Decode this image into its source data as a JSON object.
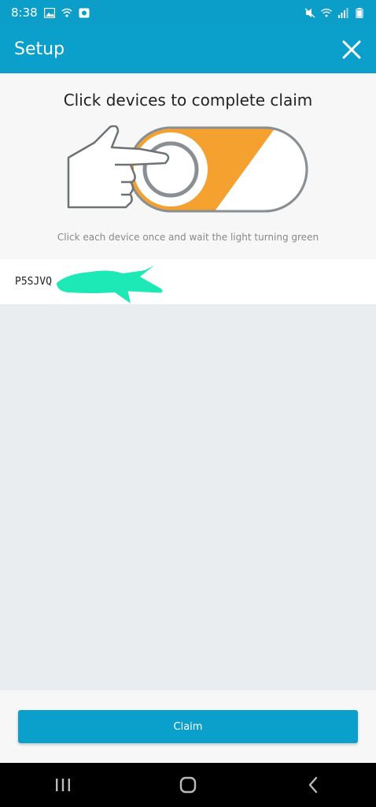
{
  "status_bar": {
    "time": "8:38",
    "left_icons": [
      "image-icon",
      "wifi-calling-icon",
      "app-notification-icon"
    ],
    "right_icons": [
      "mute-icon",
      "wifi-icon",
      "signal-icon",
      "battery-icon"
    ]
  },
  "app_bar": {
    "title": "Setup",
    "close_icon": "close-icon"
  },
  "hero": {
    "title": "Click devices to complete claim",
    "subtitle": "Click each device once and wait the light turning green"
  },
  "devices": [
    {
      "name": "P5SJVQ"
    }
  ],
  "claim_button": {
    "label": "Claim"
  },
  "nav_bar": [
    "recent-apps-icon",
    "home-icon",
    "back-icon"
  ],
  "colors": {
    "primary": "#0aa0cb",
    "accent_orange": "#f5a12f",
    "background": "#eaedf0"
  }
}
